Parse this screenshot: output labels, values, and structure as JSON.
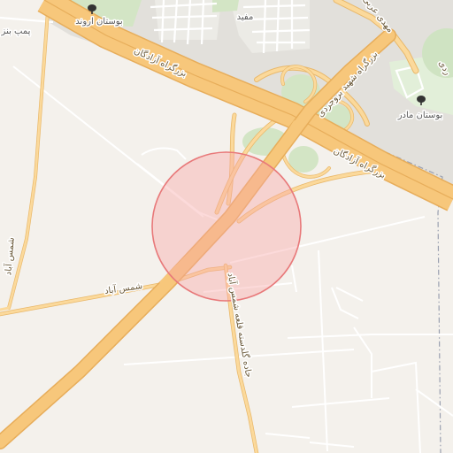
{
  "map": {
    "labels": {
      "highway_north": "بزرگراه آزادگان",
      "highway_south": "بزرگراه آزادگان",
      "boroujerdi": "بزرگراه شهید بروجردی",
      "shams_abad_h": "شمس آباد",
      "shams_abad_v": "شمس آباد",
      "qale_road": "جاده گلدسته قلعه شمس آباد",
      "mofid": "مفید",
      "mahdi_arabi": "مهدی عربی",
      "ardi": "ردی",
      "pomp_benzin": "پمپ بنز",
      "park_arvand": "بوستان اروند",
      "park_madar": "بوستان مادر"
    },
    "icons": [
      "tree-icon",
      "tree-icon"
    ],
    "colors": {
      "background": "#f4f1ec",
      "highway": "#f7c77b",
      "primary_road": "#fbd99b",
      "minor_road": "#ffffff",
      "green": "#cfe3c2",
      "urban": "#e0ded9",
      "boundary": "#9aa0b0",
      "marker_fill": "#f7a6a6",
      "marker_stroke": "#e8797a"
    }
  }
}
